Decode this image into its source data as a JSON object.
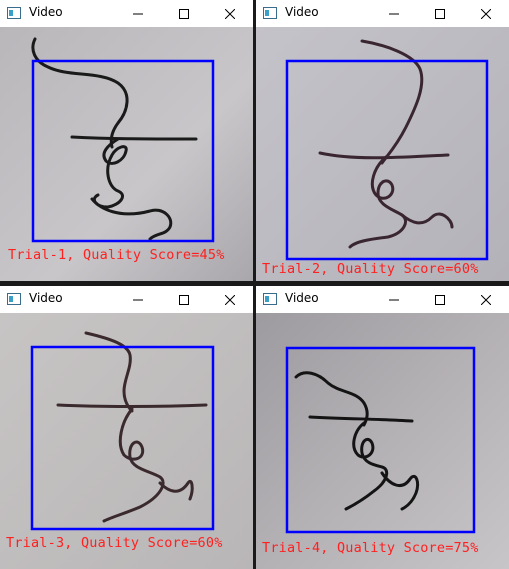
{
  "windows": [
    {
      "title": "Video",
      "caption": "Trial-1, Quality Score=45%",
      "quality_score_percent": 45,
      "trial": 1
    },
    {
      "title": "Video",
      "caption": "Trial-2, Quality Score=60%",
      "quality_score_percent": 60,
      "trial": 2
    },
    {
      "title": "Video",
      "caption": "Trial-3, Quality Score=60%",
      "quality_score_percent": 60,
      "trial": 3
    },
    {
      "title": "Video",
      "caption": "Trial-4, Quality Score=75%",
      "quality_score_percent": 75,
      "trial": 4
    }
  ],
  "controls": {
    "minimize_icon": "minimize-icon",
    "maximize_icon": "maximize-icon",
    "close_icon": "close-icon"
  },
  "colors": {
    "bounding_box": "#0000ff",
    "caption_text": "#ff2020",
    "ink": "#1a1a1a"
  }
}
